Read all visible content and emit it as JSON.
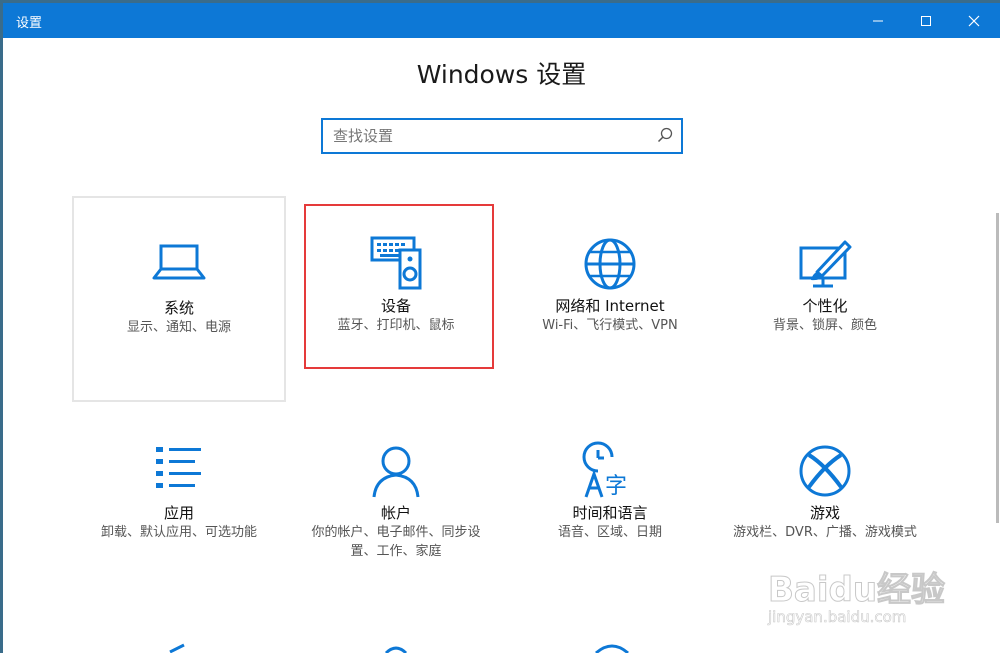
{
  "window": {
    "title": "设置"
  },
  "heading": "Windows 设置",
  "search": {
    "placeholder": "查找设置"
  },
  "tiles": [
    {
      "title": "系统",
      "desc": "显示、通知、电源",
      "icon": "laptop-icon"
    },
    {
      "title": "设备",
      "desc": "蓝牙、打印机、鼠标",
      "icon": "keyboard-speaker-icon"
    },
    {
      "title": "网络和 Internet",
      "desc": "Wi-Fi、飞行模式、VPN",
      "icon": "globe-icon"
    },
    {
      "title": "个性化",
      "desc": "背景、锁屏、颜色",
      "icon": "paintbrush-monitor-icon"
    },
    {
      "title": "应用",
      "desc": "卸载、默认应用、可选功能",
      "icon": "list-icon"
    },
    {
      "title": "帐户",
      "desc": "你的帐户、电子邮件、同步设置、工作、家庭",
      "icon": "person-icon"
    },
    {
      "title": "时间和语言",
      "desc": "语音、区域、日期",
      "icon": "clock-language-icon"
    },
    {
      "title": "游戏",
      "desc": "游戏栏、DVR、广播、游戏模式",
      "icon": "xbox-icon"
    }
  ],
  "watermark": {
    "logo": "Baidu经验",
    "url": "jingyan.baidu.com"
  },
  "colors": {
    "accent": "#0d78d6",
    "highlight": "#e53a3a",
    "titlebar": "#0d78d6"
  }
}
